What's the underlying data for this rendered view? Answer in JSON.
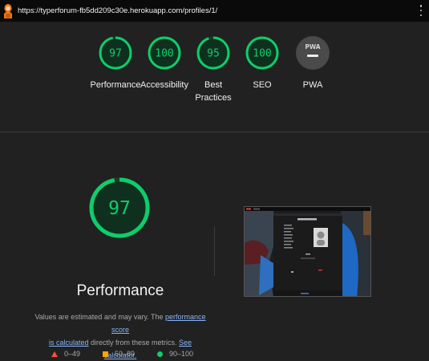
{
  "browser": {
    "url": "https://typerforum-fb5dd209c30e.herokuapp.com/profiles/1/"
  },
  "summary": {
    "gauges": [
      {
        "score": "97",
        "label": "Performance",
        "score_fraction": 0.97
      },
      {
        "score": "100",
        "label": "Accessibility",
        "score_fraction": 1.0
      },
      {
        "score": "95",
        "label_line1": "Best",
        "label_line2": "Practices",
        "score_fraction": 0.95
      },
      {
        "score": "100",
        "label": "SEO",
        "score_fraction": 1.0
      },
      {
        "badge": "PWA",
        "label": "PWA"
      }
    ]
  },
  "performance": {
    "score": "97",
    "score_fraction": 0.97,
    "title": "Performance",
    "desc_text1": "Values are estimated and may vary. The ",
    "desc_link1a": "performance score",
    "desc_link1b": "is calculated",
    "desc_text2": " directly from these metrics. ",
    "desc_link2": "See calculator."
  },
  "legend": {
    "fail": "0–49",
    "average": "50–89",
    "pass": "90–100"
  },
  "colors": {
    "pass": "#0cce6b",
    "average": "#ffa400",
    "fail": "#ff4e42",
    "link": "#8ab4f8"
  }
}
